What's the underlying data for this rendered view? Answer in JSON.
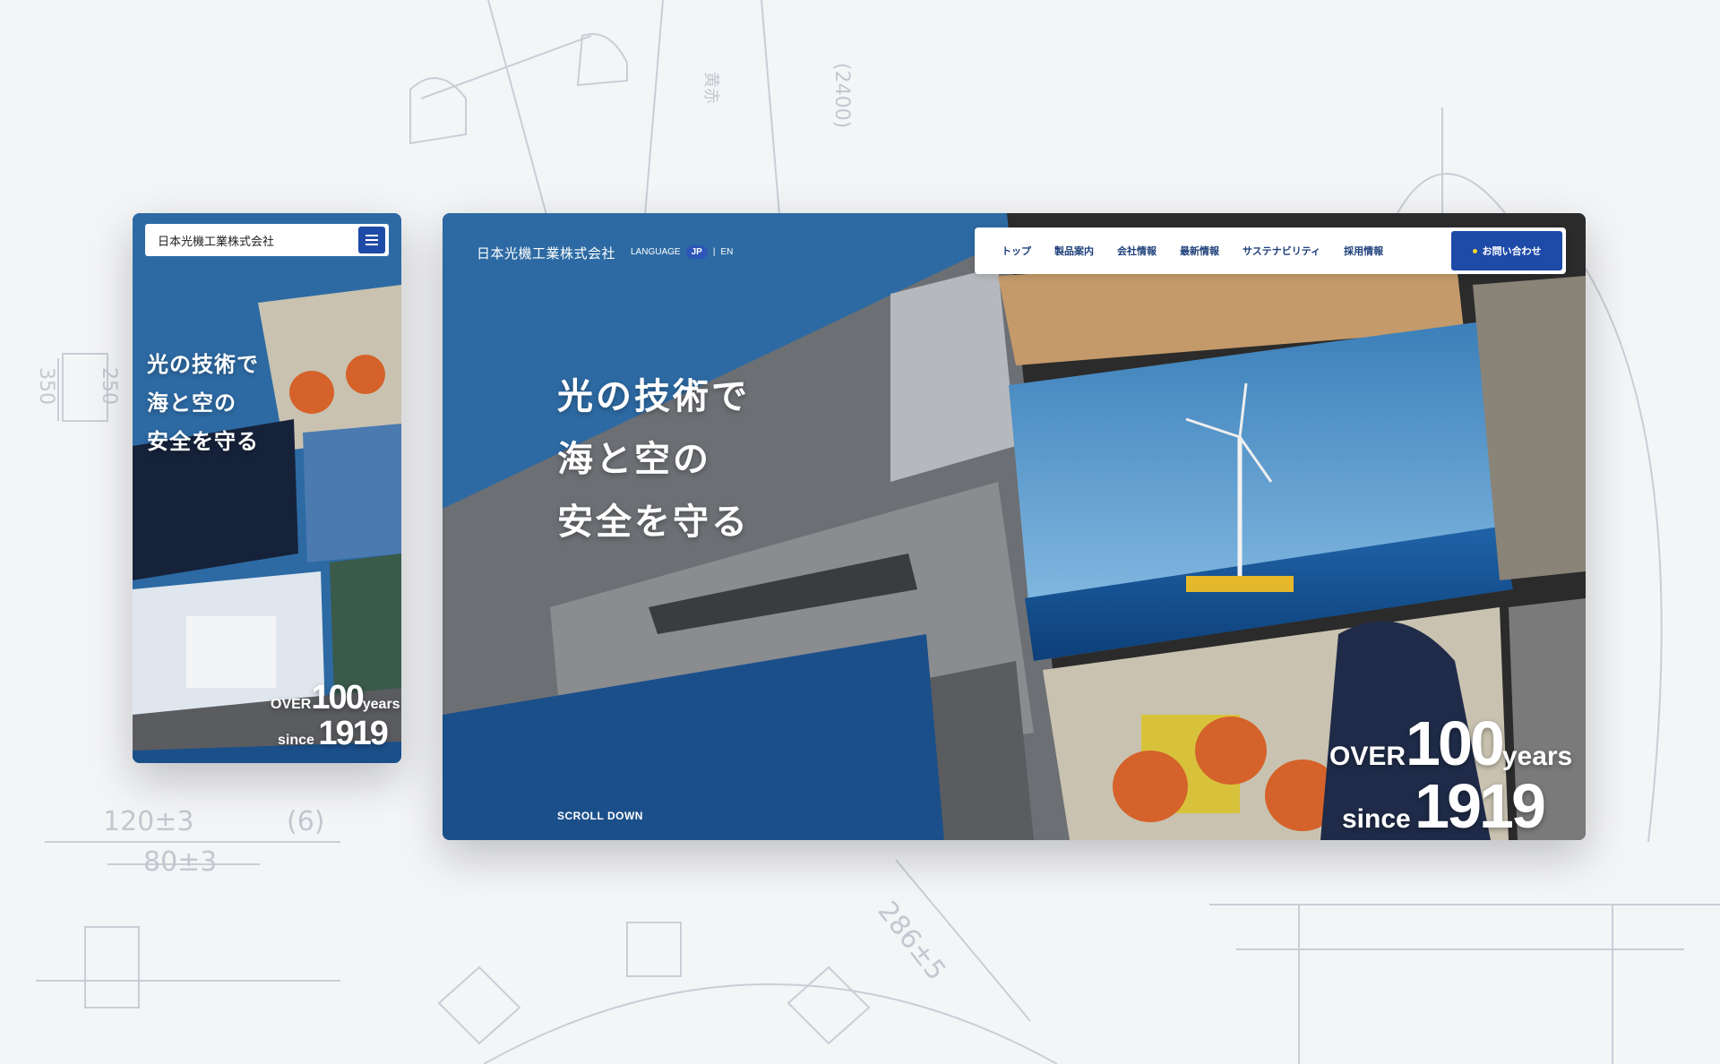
{
  "background": {
    "dimensions": [
      "120±3",
      "80±3",
      "(6)",
      "286±5",
      "350",
      "250",
      "(2400)",
      "黄赤"
    ]
  },
  "desktop": {
    "logo": "日本光機工業株式会社",
    "language": {
      "label": "LANGUAGE",
      "active": "JP",
      "separator": "|",
      "other": "EN"
    },
    "nav": [
      "トップ",
      "製品案内",
      "会社情報",
      "最新情報",
      "サステナビリティ",
      "採用情報"
    ],
    "contact_label": "お問い合わせ",
    "headline": [
      "光の技術で",
      "海と空の",
      "安全を守る"
    ],
    "badge": {
      "over": "OVER",
      "hundred": "100",
      "years": "years",
      "since": "since",
      "year": "1919"
    },
    "scroll_label": "SCROLL DOWN"
  },
  "mobile": {
    "logo": "日本光機工業株式会社",
    "headline": [
      "光の技術で",
      "海と空の",
      "安全を守る"
    ],
    "badge": {
      "over": "OVER",
      "hundred": "100",
      "years": "years",
      "since": "since",
      "year": "1919"
    }
  },
  "colors": {
    "brand_blue": "#1e4aa8",
    "accent_yellow": "#f5d52a"
  }
}
